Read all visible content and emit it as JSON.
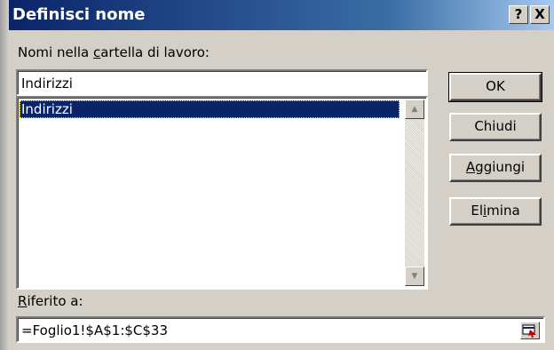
{
  "window": {
    "title": "Definisci nome"
  },
  "title_buttons": {
    "help": "?",
    "close": "X"
  },
  "names_label": {
    "before": "Nomi nella ",
    "accel": "c",
    "after": "artella di lavoro:"
  },
  "name_input": {
    "value": "Indirizzi"
  },
  "names_list": {
    "items": [
      "Indirizzi"
    ],
    "selected_index": 0
  },
  "buttons": {
    "ok": {
      "label": "OK"
    },
    "close": {
      "label": "Chiudi"
    },
    "add": {
      "accel": "A",
      "rest": "ggiungi"
    },
    "delete": {
      "before": "El",
      "accel": "i",
      "after": "mina"
    }
  },
  "ref_label": {
    "accel": "R",
    "rest": "iferito a:"
  },
  "ref_input": {
    "value": "=Foglio1!$A$1:$C$33"
  },
  "icons": {
    "ref_button": "range-select-icon",
    "scroll_up": "up-arrow-icon",
    "scroll_down": "down-arrow-icon"
  },
  "colors": {
    "titlebar": "#0a246a",
    "selection": "#0a246a",
    "face": "#d4d0c8"
  }
}
